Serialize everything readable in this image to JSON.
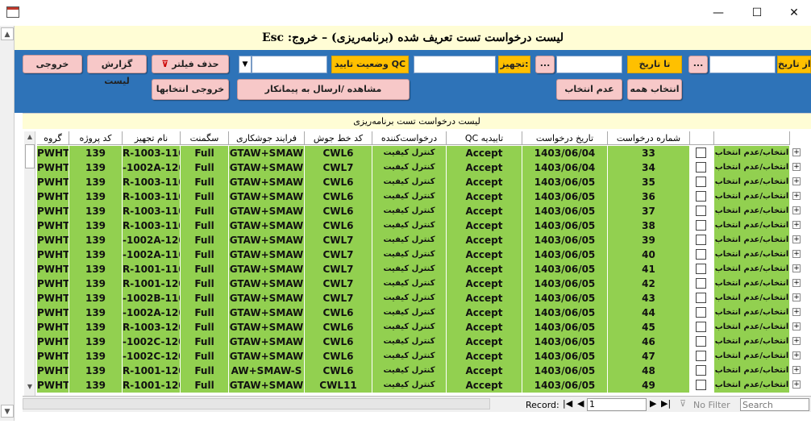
{
  "window": {
    "minimize": "—",
    "maximize": "☐",
    "close": "✕"
  },
  "form": {
    "title": "لیست درخواست تست تعریف شده (برنامه‌ریزی)  –  خروج: Esc"
  },
  "toolbar": {
    "exit_label": "خروجی",
    "report_label": "گزارش لیست",
    "clear_filter_label": "حذف فیلتر",
    "qc_status_label": "وضعیت تایید QC",
    "equipment_label": "تجهیز:",
    "to_date_label": "تا تاریخ",
    "from_date_label": "از تاریخ",
    "ellipsis": "...",
    "export_selected_label": "خروجی انتخابها",
    "view_send_label": "مشاهده /ارسال به پیمانکار",
    "deselect_label": "عدم انتخاب",
    "select_all_label": "انتخاب همه"
  },
  "subtitle": "لیست درخواست تست برنامه‌ریزی",
  "columns": [
    "گروه",
    "کد پروژه",
    "نام تجهیز",
    "سگمنت",
    "فرایند جوشکاری",
    "کد خط جوش",
    "درخواست‌کننده",
    "تاییدیه QC",
    "تاریخ درخواست",
    "شماره درخواست",
    "",
    ""
  ],
  "select_toggle_label": "انتخاب/عدم انتخاب",
  "rows": [
    {
      "group": "PWHT",
      "project": "139",
      "equipment": "R-1003-1100",
      "segment": "Full",
      "process": "GTAW+SMAW",
      "weld": "CWL6",
      "requester": "کنترل کیفیت",
      "qc": "Accept",
      "date": "1403/06/04",
      "num": "33"
    },
    {
      "group": "PWHT",
      "project": "139",
      "equipment": "-1002A-120",
      "segment": "Full",
      "process": "GTAW+SMAW",
      "weld": "CWL7",
      "requester": "کنترل کیفیت",
      "qc": "Accept",
      "date": "1403/06/04",
      "num": "34"
    },
    {
      "group": "PWHT",
      "project": "139",
      "equipment": "R-1003-1100",
      "segment": "Full",
      "process": "GTAW+SMAW",
      "weld": "CWL6",
      "requester": "کنترل کیفیت",
      "qc": "Accept",
      "date": "1403/06/05",
      "num": "35"
    },
    {
      "group": "PWHT",
      "project": "139",
      "equipment": "R-1003-1100",
      "segment": "Full",
      "process": "GTAW+SMAW",
      "weld": "CWL6",
      "requester": "کنترل کیفیت",
      "qc": "Accept",
      "date": "1403/06/05",
      "num": "36"
    },
    {
      "group": "PWHT",
      "project": "139",
      "equipment": "R-1003-1100",
      "segment": "Full",
      "process": "GTAW+SMAW",
      "weld": "CWL6",
      "requester": "کنترل کیفیت",
      "qc": "Accept",
      "date": "1403/06/05",
      "num": "37"
    },
    {
      "group": "PWHT",
      "project": "139",
      "equipment": "R-1003-1100",
      "segment": "Full",
      "process": "GTAW+SMAW",
      "weld": "CWL6",
      "requester": "کنترل کیفیت",
      "qc": "Accept",
      "date": "1403/06/05",
      "num": "38"
    },
    {
      "group": "PWHT",
      "project": "139",
      "equipment": "-1002A-120",
      "segment": "Full",
      "process": "GTAW+SMAW",
      "weld": "CWL7",
      "requester": "کنترل کیفیت",
      "qc": "Accept",
      "date": "1403/06/05",
      "num": "39"
    },
    {
      "group": "PWHT",
      "project": "139",
      "equipment": "-1002A-110",
      "segment": "Full",
      "process": "GTAW+SMAW",
      "weld": "CWL7",
      "requester": "کنترل کیفیت",
      "qc": "Accept",
      "date": "1403/06/05",
      "num": "40"
    },
    {
      "group": "PWHT",
      "project": "139",
      "equipment": "R-1001-1100",
      "segment": "Full",
      "process": "GTAW+SMAW",
      "weld": "CWL7",
      "requester": "کنترل کیفیت",
      "qc": "Accept",
      "date": "1403/06/05",
      "num": "41"
    },
    {
      "group": "PWHT",
      "project": "139",
      "equipment": "R-1001-1200",
      "segment": "Full",
      "process": "GTAW+SMAW",
      "weld": "CWL7",
      "requester": "کنترل کیفیت",
      "qc": "Accept",
      "date": "1403/06/05",
      "num": "42"
    },
    {
      "group": "PWHT",
      "project": "139",
      "equipment": "-1002B-110",
      "segment": "Full",
      "process": "GTAW+SMAW",
      "weld": "CWL7",
      "requester": "کنترل کیفیت",
      "qc": "Accept",
      "date": "1403/06/05",
      "num": "43"
    },
    {
      "group": "PWHT",
      "project": "139",
      "equipment": "-1002A-120",
      "segment": "Full",
      "process": "GTAW+SMAW",
      "weld": "CWL6",
      "requester": "کنترل کیفیت",
      "qc": "Accept",
      "date": "1403/06/05",
      "num": "44"
    },
    {
      "group": "PWHT",
      "project": "139",
      "equipment": "R-1003-1200",
      "segment": "Full",
      "process": "GTAW+SMAW",
      "weld": "CWL6",
      "requester": "کنترل کیفیت",
      "qc": "Accept",
      "date": "1403/06/05",
      "num": "45"
    },
    {
      "group": "PWHT",
      "project": "139",
      "equipment": "-1002C-120",
      "segment": "Full",
      "process": "GTAW+SMAW",
      "weld": "CWL6",
      "requester": "کنترل کیفیت",
      "qc": "Accept",
      "date": "1403/06/05",
      "num": "46"
    },
    {
      "group": "PWHT",
      "project": "139",
      "equipment": "-1002C-120",
      "segment": "Full",
      "process": "GTAW+SMAW",
      "weld": "CWL6",
      "requester": "کنترل کیفیت",
      "qc": "Accept",
      "date": "1403/06/05",
      "num": "47"
    },
    {
      "group": "PWHT",
      "project": "139",
      "equipment": "R-1001-1200",
      "segment": "Full",
      "process": "AW+SMAW-S",
      "weld": "CWL6",
      "requester": "کنترل کیفیت",
      "qc": "Accept",
      "date": "1403/06/05",
      "num": "48"
    },
    {
      "group": "PWHT",
      "project": "139",
      "equipment": "R-1001-1200",
      "segment": "Full",
      "process": "GTAW+SMAW",
      "weld": "CWL11",
      "requester": "کنترل کیفیت",
      "qc": "Accept",
      "date": "1403/06/05",
      "num": "49"
    }
  ],
  "navbar": {
    "record_label": "Record:",
    "record_value": "1",
    "no_filter": "No Filter",
    "search_placeholder": "Search"
  }
}
